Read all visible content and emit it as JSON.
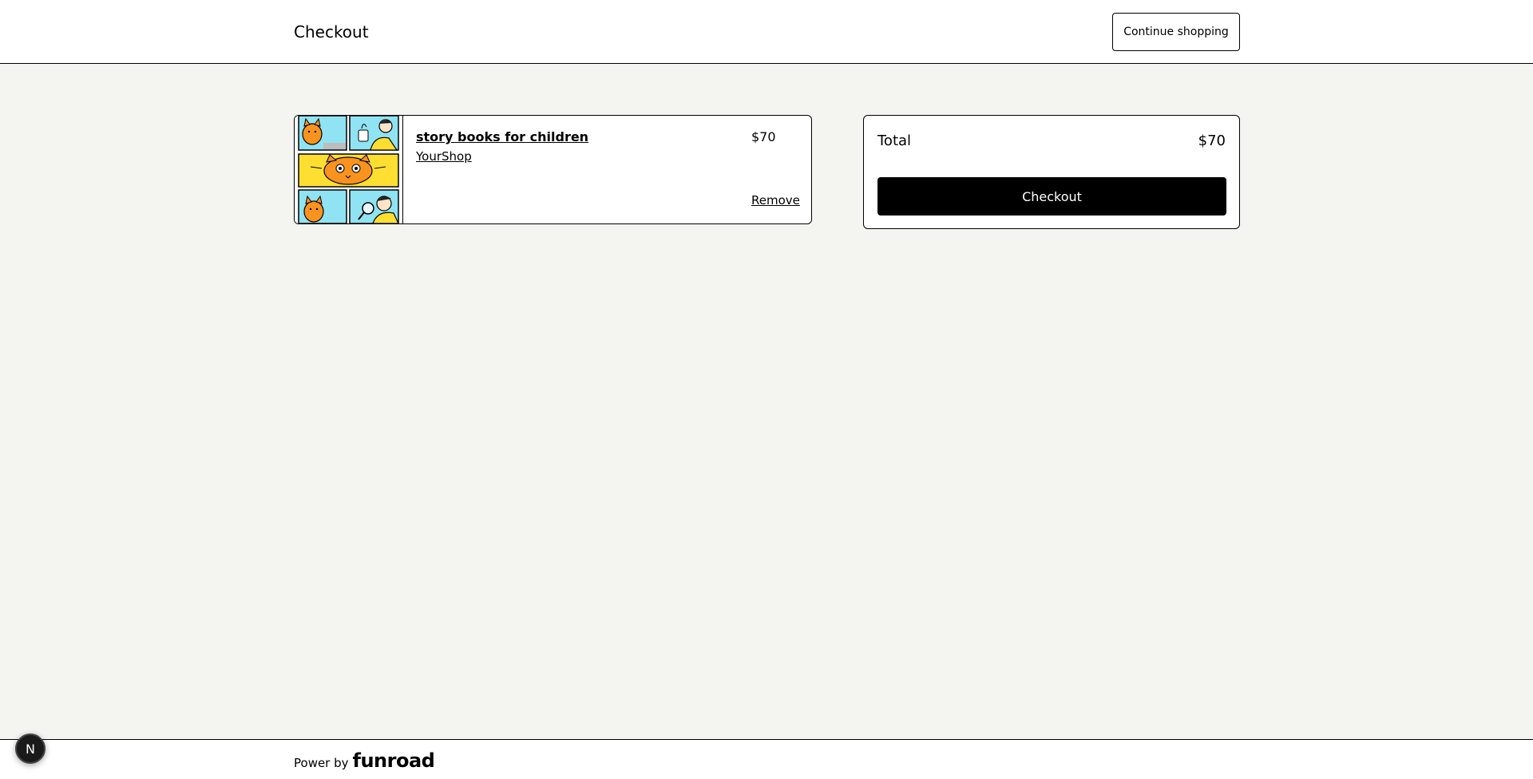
{
  "header": {
    "title": "Checkout",
    "continue_label": "Continue shopping"
  },
  "cart": {
    "items": [
      {
        "name": "story books for children",
        "shop": "YourShop",
        "price": "$70",
        "remove_label": "Remove",
        "thumbnail_icon": "comic-cat-illustration"
      }
    ]
  },
  "summary": {
    "total_label": "Total",
    "total_value": "$70",
    "checkout_label": "Checkout"
  },
  "footer": {
    "power_by": "Power by",
    "brand": "funroad"
  },
  "badge": {
    "letter": "N"
  },
  "colors": {
    "page_bg": "#f4f4f0",
    "button_dark": "#000000",
    "panel_yellow": "#ffde32",
    "panel_cyan": "#8fe3f2",
    "cat_orange": "#f7931e"
  }
}
